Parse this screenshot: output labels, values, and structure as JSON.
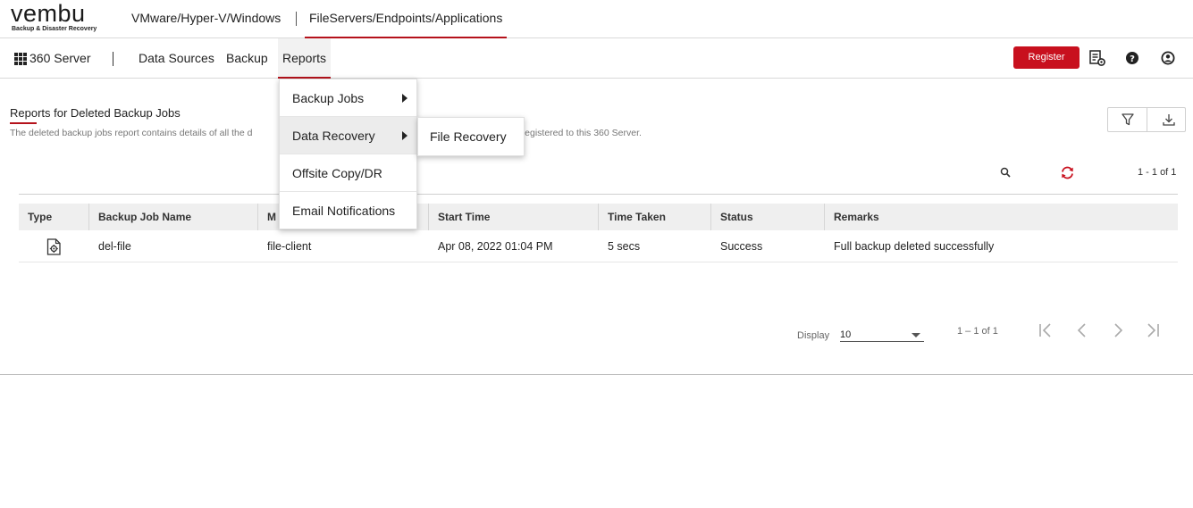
{
  "brand": {
    "logo_text": "vembu",
    "tagline": "Backup & Disaster Recovery"
  },
  "product_tabs": [
    {
      "label": "VMware/Hyper-V/Windows",
      "active": false
    },
    {
      "label": "FileServers/Endpoints/Applications",
      "active": true
    }
  ],
  "nav": {
    "server_label": "360 Server",
    "items": [
      {
        "label": "Data Sources"
      },
      {
        "label": "Backup"
      },
      {
        "label": "Reports",
        "active": true
      }
    ],
    "register_label": "Register",
    "icons": [
      "report-settings-icon",
      "help-icon",
      "user-icon"
    ]
  },
  "page": {
    "title": "Reports for Deleted Backup Jobs",
    "description_start": "The deleted backup jobs report contains details of all the d",
    "description_end": "rs registered to this 360 Server."
  },
  "toolbar": {
    "count_text": "1 - 1 of 1"
  },
  "table": {
    "headers": [
      "Type",
      "Backup Job Name",
      "M",
      "Start Time",
      "Time Taken",
      "Status",
      "Remarks"
    ],
    "rows": [
      {
        "type_icon": "file-backup-icon",
        "job_name": "del-file",
        "machine": "file-client",
        "start_time": "Apr 08, 2022 01:04 PM",
        "time_taken": "5 secs",
        "status": "Success",
        "remarks": "Full backup deleted successfully"
      }
    ]
  },
  "pagination": {
    "display_label": "Display",
    "page_size": "10",
    "count_text": "1 – 1 of 1"
  },
  "reports_menu": {
    "items": [
      {
        "label": "Backup Jobs",
        "has_submenu": true
      },
      {
        "label": "Data Recovery",
        "has_submenu": true,
        "highlighted": true
      },
      {
        "label": "Offsite Copy/DR",
        "has_submenu": false
      },
      {
        "label": "Email Notifications",
        "has_submenu": false
      }
    ],
    "submenu": {
      "items": [
        {
          "label": "File Recovery"
        }
      ]
    }
  },
  "colors": {
    "accent": "#b5121b",
    "register_bg": "#c8101e",
    "header_bg": "#efefef"
  }
}
